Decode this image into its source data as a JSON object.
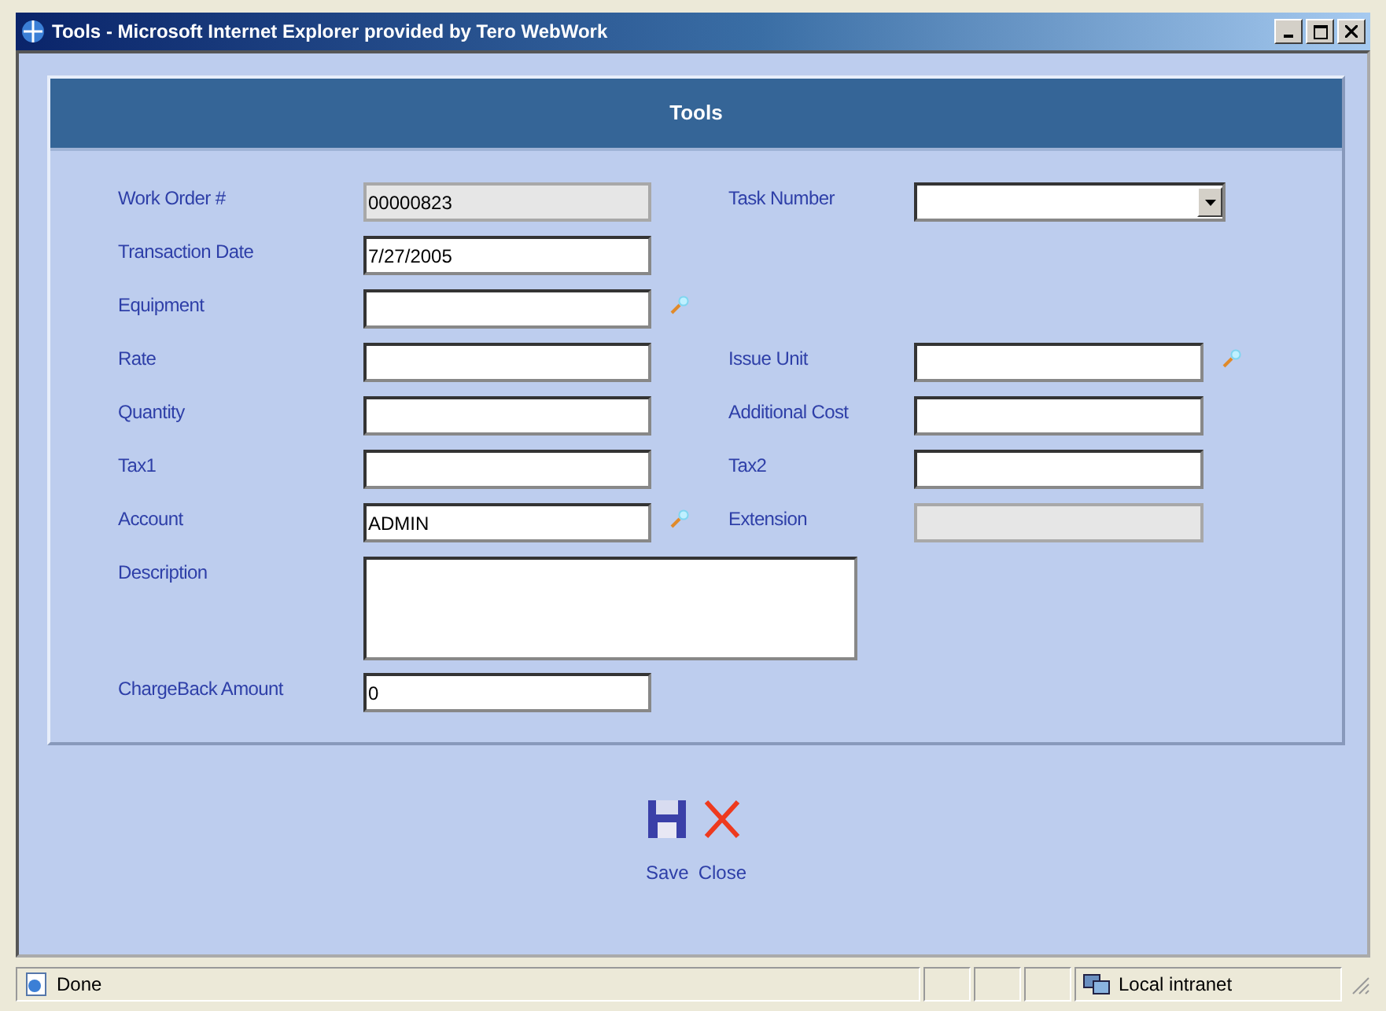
{
  "window": {
    "title": "Tools - Microsoft Internet Explorer provided by Tero WebWork"
  },
  "form": {
    "title": "Tools",
    "rows": [
      {
        "left": {
          "label": "Work Order #",
          "value": "00000823",
          "kind": "text",
          "disabled": true
        },
        "right": {
          "label": "Task Number",
          "kind": "select",
          "disabled": false
        }
      },
      {
        "left": {
          "label": "Transaction Date",
          "value": "7/27/2005",
          "kind": "text",
          "disabled": false
        }
      },
      {
        "left": {
          "label": "Equipment",
          "kind": "lookup",
          "disabled": false
        }
      },
      {
        "left": {
          "label": "Rate",
          "kind": "text",
          "disabled": false
        },
        "right": {
          "label": "Issue Unit",
          "kind": "lookup",
          "disabled": false
        }
      },
      {
        "left": {
          "label": "Quantity",
          "kind": "text",
          "disabled": false
        },
        "right": {
          "label": "Additional Cost",
          "kind": "text",
          "disabled": false
        }
      },
      {
        "left": {
          "label": "Tax1",
          "kind": "text",
          "disabled": false
        },
        "right": {
          "label": "Tax2",
          "kind": "text",
          "disabled": false
        }
      },
      {
        "left": {
          "label": "Account",
          "value": "ADMIN",
          "kind": "lookup",
          "disabled": false
        },
        "right": {
          "label": "Extension",
          "kind": "text",
          "disabled": true
        }
      },
      {
        "left": {
          "label": "Description",
          "kind": "textarea",
          "disabled": false
        }
      },
      {
        "left": {
          "label": "ChargeBack Amount",
          "value": "0",
          "kind": "text",
          "disabled": false
        }
      }
    ]
  },
  "actions": [
    {
      "label": "Save",
      "kind": "save"
    },
    {
      "label": "Close",
      "kind": "close"
    }
  ],
  "status_bar": {
    "text": "Done",
    "zone": "Local intranet"
  }
}
